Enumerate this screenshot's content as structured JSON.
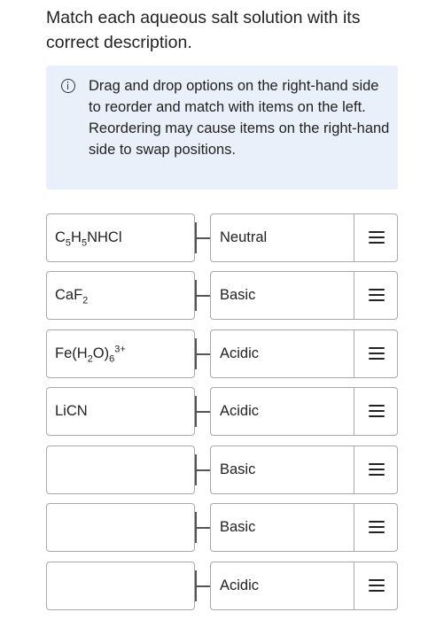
{
  "question": "Match each aqueous salt solution with its correct description.",
  "info": {
    "line1": "Drag and drop options on the right-hand side to reorder and match with items on the left.",
    "line2": "Reordering may cause items on the right-hand side to swap positions."
  },
  "rows": [
    {
      "left_html": "C<sub>5</sub>H<sub>5</sub>NHCl",
      "right": "Neutral"
    },
    {
      "left_html": "CaF<sub>2</sub>",
      "right": "Basic"
    },
    {
      "left_html": "Fe(H<sub>2</sub>O)<sub>6</sub><sup>3+</sup>",
      "right": "Acidic"
    },
    {
      "left_html": "LiCN",
      "right": "Acidic"
    },
    {
      "left_html": "",
      "right": "Basic"
    },
    {
      "left_html": "",
      "right": "Basic"
    },
    {
      "left_html": "",
      "right": "Acidic"
    }
  ]
}
